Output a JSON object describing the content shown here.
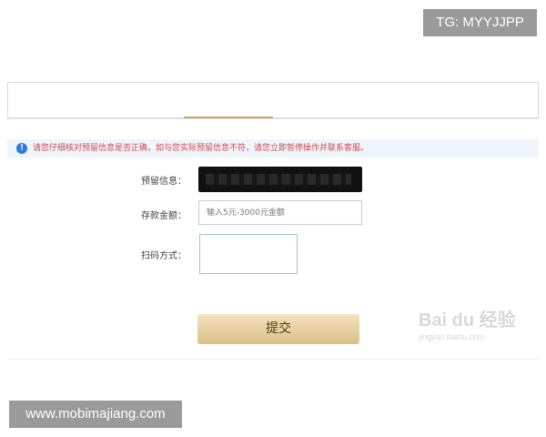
{
  "overlay": {
    "tg_label": "TG: MYYJJPP",
    "site_label": "www.mobimajiang.com",
    "watermark_text": "Bai du 经验",
    "watermark_sub": "jingyan.baidu.com"
  },
  "notice": {
    "icon": "info-icon",
    "text": "请您仔细核对预留信息是否正确，如与您实际预留信息不符，请您立即暂停操作并联系客服。"
  },
  "form": {
    "reserved_label": "预留信息：",
    "amount_label": "存款金额：",
    "amount_placeholder": "输入5元-3000元金额",
    "scan_label": "扫码方式："
  },
  "actions": {
    "submit_label": "提交"
  },
  "colors": {
    "accent": "#c9a367",
    "notice_text": "#d04b4b",
    "notice_bg": "#eef5fb",
    "info_icon": "#2d7cd6"
  }
}
